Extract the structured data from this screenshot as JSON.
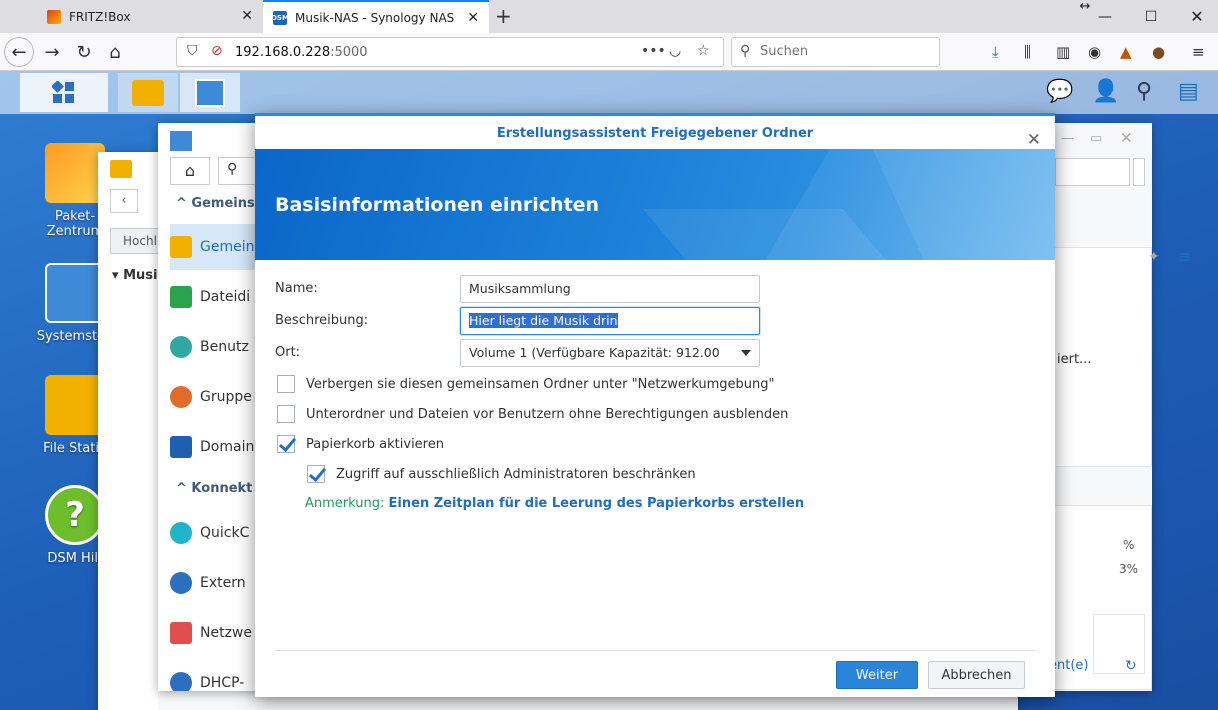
{
  "browser": {
    "tabs": [
      {
        "title": "FRITZ!Box",
        "active": false
      },
      {
        "title": "Musik-NAS - Synology NAS",
        "active": true,
        "favicon_text": "DSM"
      }
    ],
    "url_host": "192.168.0.228",
    "url_port": ":5000",
    "search_placeholder": "Suchen",
    "icons": [
      "back-icon",
      "forward-icon",
      "reload-icon",
      "home-icon",
      "shield-icon",
      "insecure-lock-icon",
      "more-icon",
      "pocket-icon",
      "star-icon",
      "search-icon",
      "download-icon",
      "library-icon",
      "sidebar-icon",
      "account-icon",
      "extension-icon",
      "extension2-icon",
      "menu-icon"
    ]
  },
  "desktop": {
    "icons": [
      {
        "label_line1": "Paket-",
        "label_line2": "Zentrum"
      },
      {
        "label_line1": "Systemsteu",
        "label_line2": ""
      },
      {
        "label_line1": "File Statio",
        "label_line2": ""
      },
      {
        "label_line1": "DSM Hilf",
        "label_line2": ""
      }
    ]
  },
  "control_panel_bg": {
    "group1": "Gemeins",
    "group2": "Konnekt",
    "items": [
      "Gemein",
      "Dateidi",
      "Benutz",
      "Gruppe",
      "Domain",
      "QuickC",
      "Extern",
      "Netzwe",
      "DHCP-"
    ],
    "right_text1": "iert...",
    "right_pct1": "%",
    "right_pct2": "3%",
    "right_link": "ent(e)"
  },
  "file_station_bg": {
    "btn": "Hochl",
    "tree_item": "Musi"
  },
  "wizard": {
    "window_title": "Erstellungsassistent Freigegebener Ordner",
    "heading": "Basisinformationen einrichten",
    "name_label": "Name:",
    "name_value": "Musiksammlung",
    "desc_label": "Beschreibung:",
    "desc_value": "Hier liegt die Musik drin",
    "location_label": "Ort:",
    "location_value": "Volume 1 (Verfügbare Kapazität:  912.00",
    "options": [
      {
        "label": "Verbergen sie diesen gemeinsamen Ordner unter \"Netzwerkumgebung\"",
        "checked": false
      },
      {
        "label": "Unterordner und Dateien vor Benutzern ohne Berechtigungen ausblenden",
        "checked": false
      },
      {
        "label": "Papierkorb aktivieren",
        "checked": true
      },
      {
        "label": "Zugriff auf ausschließlich Administratoren beschränken",
        "checked": true
      }
    ],
    "note_label": "Anmerkung:",
    "note_link": "Einen Zeitplan für die Leerung des Papierkorbs erstellen",
    "next_button": "Weiter",
    "cancel_button": "Abbrechen"
  },
  "colors": {
    "accent": "#2a85d8",
    "banner": "#1b7fd8",
    "note_green": "#1e9b5f",
    "desktop_bg": "#1e5fb8"
  }
}
